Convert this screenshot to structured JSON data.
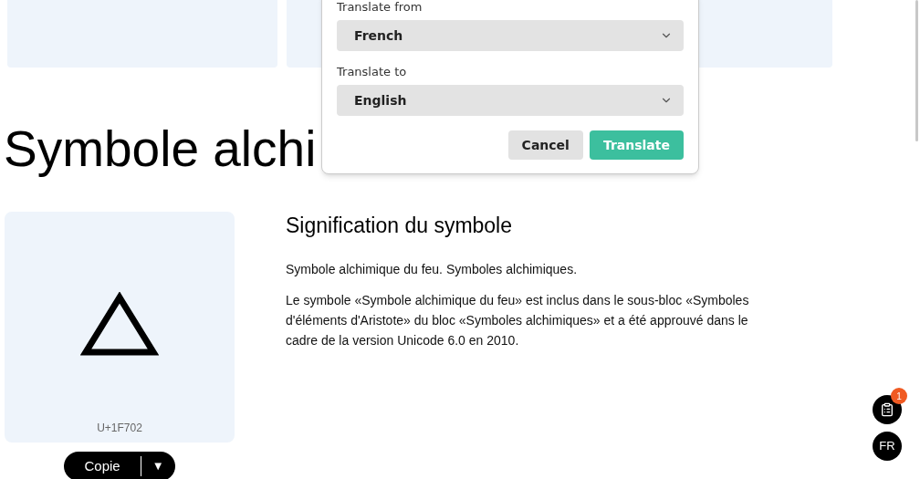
{
  "page_title": "Symbole alchi",
  "symbol_card": {
    "code": "U+1F702"
  },
  "copy_button": {
    "label": "Copie",
    "caret": "▼"
  },
  "meaning": {
    "heading": "Signification du symbole",
    "paragraphs": [
      "Symbole alchimique du feu. Symboles alchimiques.",
      "Le symbole «Symbole alchimique du feu» est inclus dans le sous-bloc «Symboles d'éléments d'Aristote» du bloc «Symboles alchimiques» et a été approuvé dans le cadre de la version Unicode 6.0 en 2010."
    ]
  },
  "translate_popup": {
    "fields": [
      {
        "label": "Translate from",
        "value": "French"
      },
      {
        "label": "Translate to",
        "value": "English"
      }
    ],
    "buttons": [
      {
        "label": "Cancel",
        "kind": "secondary"
      },
      {
        "label": "Translate",
        "kind": "primary"
      }
    ]
  },
  "floating": {
    "clipboard_badge": "1",
    "language": "FR"
  }
}
